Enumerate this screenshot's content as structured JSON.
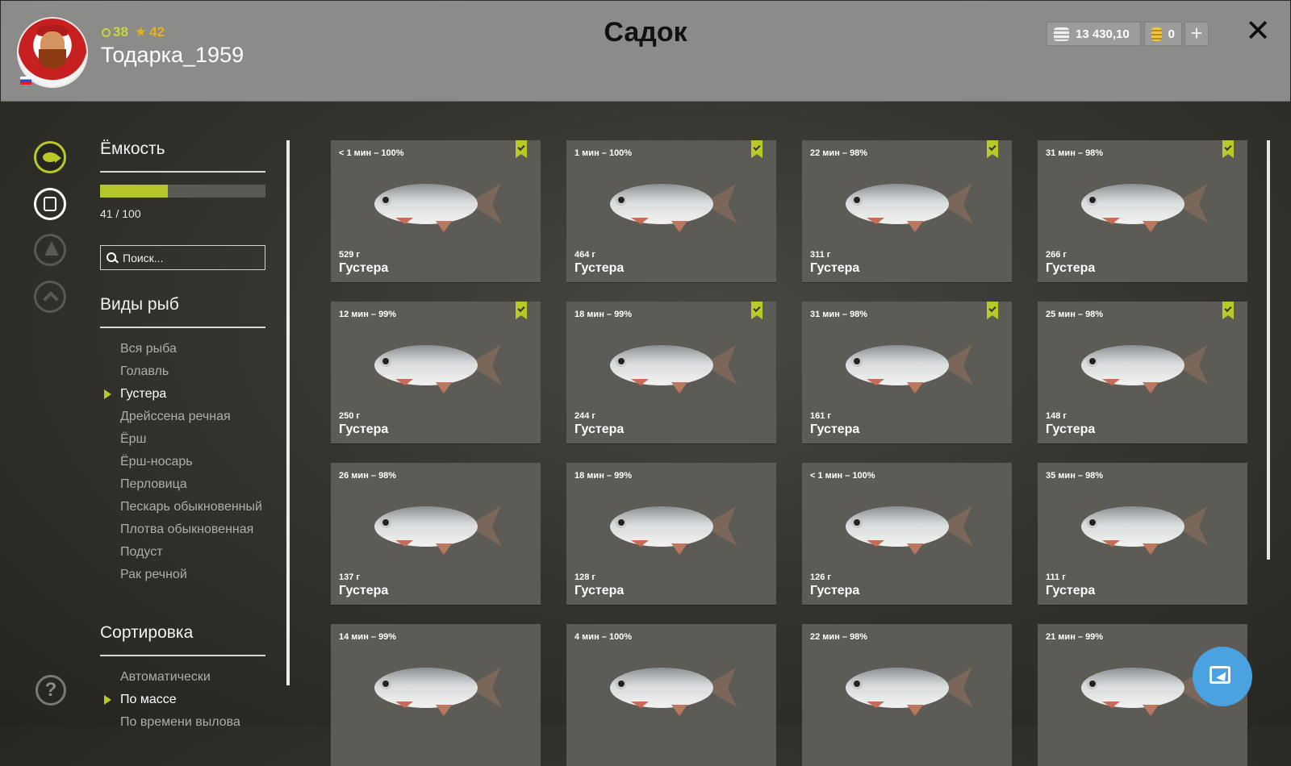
{
  "header": {
    "title": "Садок",
    "username": "Тодарка_1959",
    "level": "38",
    "rating": "42",
    "silver": "13 430,10",
    "gold": "0",
    "plus_label": "+",
    "close_label": "✕"
  },
  "rail": {
    "help_label": "?",
    "icons": [
      "fish-icon",
      "keepnet-icon",
      "tent-icon",
      "home-icon"
    ]
  },
  "capacity": {
    "heading": "Ёмкость",
    "text": "41 / 100",
    "fill_fraction": 0.41
  },
  "search": {
    "placeholder": "Поиск..."
  },
  "species": {
    "heading": "Виды рыб",
    "items": [
      "Вся рыба",
      "Голавль",
      "Густера",
      "Дрейссена речная",
      "Ёрш",
      "Ёрш-носарь",
      "Перловица",
      "Пескарь обыкновенный",
      "Плотва обыкновенная",
      "Подуст",
      "Рак речной"
    ],
    "selected_index": 2
  },
  "sorting": {
    "heading": "Сортировка",
    "items": [
      "Автоматически",
      "По массе",
      "По времени вылова"
    ],
    "selected_index": 1
  },
  "fish": [
    {
      "time": "< 1 мин – 100%",
      "weight": "529 г",
      "name": "Густера",
      "marked": true
    },
    {
      "time": "1 мин – 100%",
      "weight": "464 г",
      "name": "Густера",
      "marked": true
    },
    {
      "time": "22 мин – 98%",
      "weight": "311 г",
      "name": "Густера",
      "marked": true
    },
    {
      "time": "31 мин – 98%",
      "weight": "266 г",
      "name": "Густера",
      "marked": true
    },
    {
      "time": "12 мин – 99%",
      "weight": "250 г",
      "name": "Густера",
      "marked": true
    },
    {
      "time": "18 мин – 99%",
      "weight": "244 г",
      "name": "Густера",
      "marked": true
    },
    {
      "time": "31 мин – 98%",
      "weight": "161 г",
      "name": "Густера",
      "marked": true
    },
    {
      "time": "25 мин – 98%",
      "weight": "148 г",
      "name": "Густера",
      "marked": true
    },
    {
      "time": "26 мин – 98%",
      "weight": "137 г",
      "name": "Густера",
      "marked": false
    },
    {
      "time": "18 мин – 99%",
      "weight": "128 г",
      "name": "Густера",
      "marked": false
    },
    {
      "time": "< 1 мин – 100%",
      "weight": "126 г",
      "name": "Густера",
      "marked": false
    },
    {
      "time": "35 мин – 98%",
      "weight": "111 г",
      "name": "Густера",
      "marked": false
    },
    {
      "time": "14 мин – 99%",
      "weight": "",
      "name": "",
      "marked": false
    },
    {
      "time": "4 мин – 100%",
      "weight": "",
      "name": "",
      "marked": false
    },
    {
      "time": "22 мин – 98%",
      "weight": "",
      "name": "",
      "marked": false
    },
    {
      "time": "21 мин – 99%",
      "weight": "",
      "name": "",
      "marked": false
    }
  ],
  "colors": {
    "accent": "#b9c926",
    "header_bg": "#8b8b89",
    "card_bg": "#5c5b56",
    "action_blue": "#4aa3e0"
  }
}
